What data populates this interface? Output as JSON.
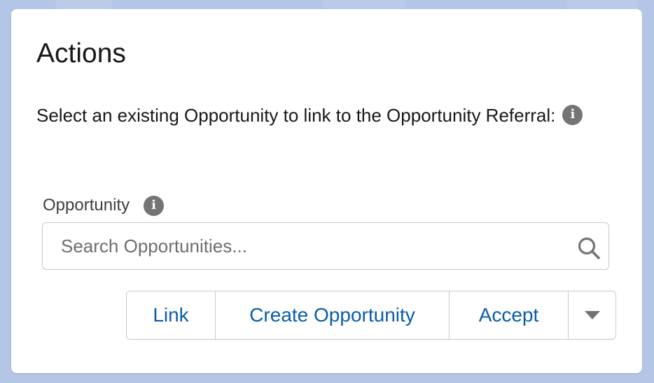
{
  "card": {
    "title": "Actions",
    "description": "Select an existing Opportunity to link to the Opportunity Referral:",
    "info_icon_glyph": "i"
  },
  "opportunity_field": {
    "label": "Opportunity",
    "placeholder": "Search Opportunities...",
    "value": "",
    "info_icon_glyph": "i",
    "search_icon": "search-icon"
  },
  "actions": {
    "link_label": "Link",
    "create_label": "Create Opportunity",
    "accept_label": "Accept",
    "more_icon": "chevron-down-icon"
  },
  "colors": {
    "background": "#b4c6e6",
    "card": "#ffffff",
    "button_text": "#0b5cab",
    "info_icon": "#747474",
    "border": "#c9c9c9"
  }
}
